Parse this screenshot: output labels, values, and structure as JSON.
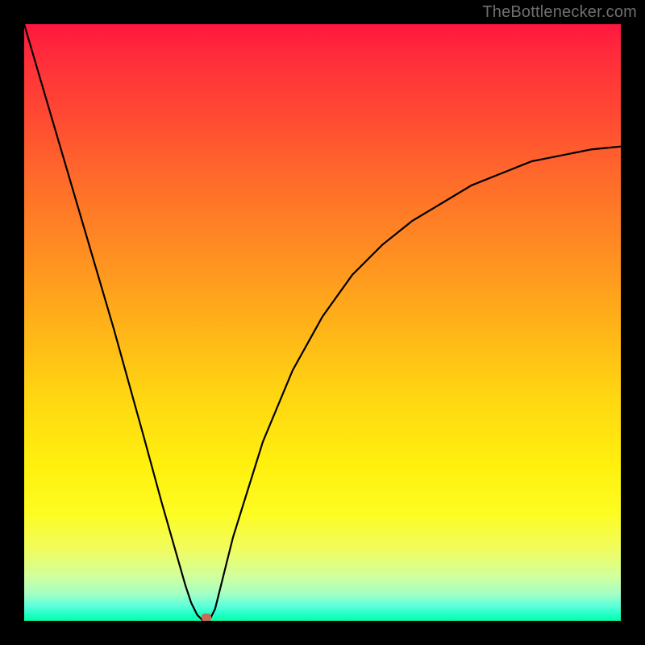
{
  "watermark": "TheBottlenecker.com",
  "colors": {
    "marker": "#c96a56",
    "curve": "#000000"
  },
  "chart_data": {
    "type": "line",
    "title": "",
    "xlabel": "",
    "ylabel": "",
    "xlim": [
      0,
      100
    ],
    "ylim": [
      0,
      100
    ],
    "grid": false,
    "background": "rainbow-vertical-red-to-green",
    "series": [
      {
        "name": "bottleneck-curve",
        "x": [
          0,
          5,
          10,
          15,
          20,
          23,
          25,
          27,
          28,
          29,
          30,
          31,
          32,
          33,
          35,
          40,
          45,
          50,
          55,
          60,
          65,
          70,
          75,
          80,
          85,
          90,
          95,
          100
        ],
        "y": [
          100,
          83,
          66,
          49,
          31,
          20,
          13,
          6,
          3,
          1,
          0,
          0,
          2,
          6,
          14,
          30,
          42,
          51,
          58,
          63,
          67,
          70,
          73,
          75,
          77,
          78,
          79,
          79.5
        ]
      }
    ],
    "marker": {
      "x": 30.5,
      "y": 0.5
    }
  }
}
